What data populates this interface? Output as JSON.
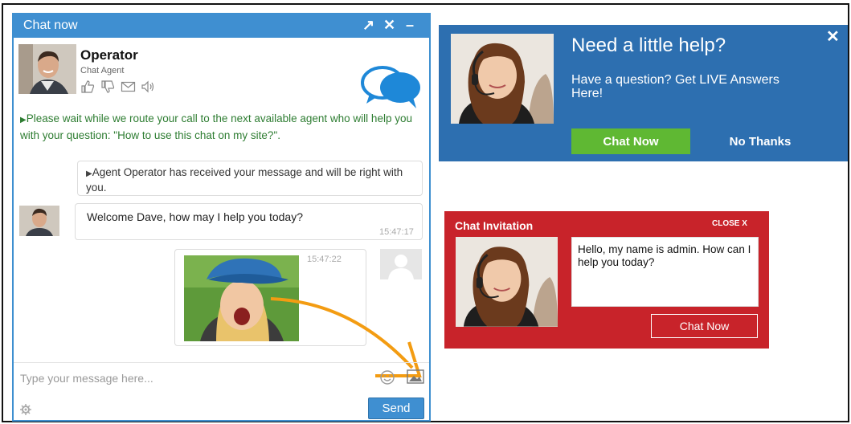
{
  "chat": {
    "title": "Chat now",
    "controls": {
      "expand": "↗",
      "close": "✕",
      "minimize": "–"
    },
    "operator": {
      "name": "Operator",
      "role": "Chat Agent",
      "actions": [
        "thumbs-up-icon",
        "thumbs-down-icon",
        "email-icon",
        "speaker-icon"
      ]
    },
    "system_message": "Please wait while we route your call to the next available agent who will help you with your question: \"How to use this chat on my site?\".",
    "agent_notice": "Agent Operator has received your message and will be right with you.",
    "welcome": {
      "text": "Welcome Dave, how may I help you today?",
      "time": "15:47:17"
    },
    "image_message": {
      "time": "15:47:22"
    },
    "input": {
      "placeholder": "Type your message here..."
    },
    "send_label": "Send"
  },
  "help": {
    "title": "Need a little help?",
    "subtitle": "Have a question? Get LIVE Answers Here!",
    "close": "✕",
    "chat_now": "Chat Now",
    "no_thanks": "No Thanks"
  },
  "invite": {
    "title": "Chat Invitation",
    "close": "CLOSE X",
    "message": "Hello, my name is admin. How can I help you today?",
    "button": "Chat Now"
  },
  "colors": {
    "chat_blue": "#3f8fd1",
    "help_blue": "#2d6fb0",
    "green": "#5fb833",
    "red": "#c8232a",
    "arrow_orange": "#f39c12"
  }
}
